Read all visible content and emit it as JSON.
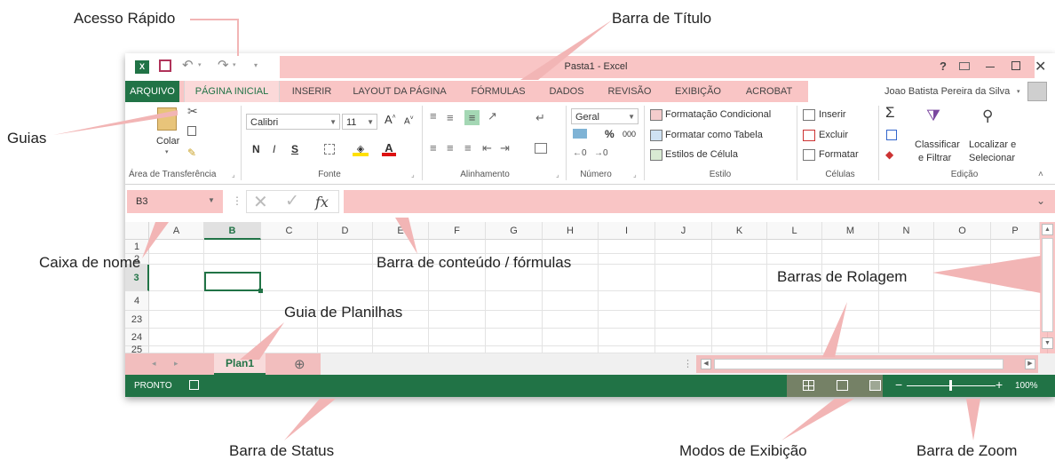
{
  "callouts": {
    "quick_access": "Acesso Rápido",
    "title_bar": "Barra de Título",
    "tabs": "Guias",
    "name_box": "Caixa de nome",
    "formula_bar": "Barra de conteúdo / fórmulas",
    "scroll_bars": "Barras de Rolagem",
    "sheet_tabs": "Guia de Planilhas",
    "status_bar": "Barra de Status",
    "view_modes": "Modos de Exibição",
    "zoom_bar": "Barra de Zoom"
  },
  "window": {
    "title": "Pasta1 - Excel",
    "help": "?",
    "user": "Joao Batista Pereira da Silva"
  },
  "tabs": [
    "PÁGINA INICIAL",
    "INSERIR",
    "LAYOUT DA PÁGINA",
    "FÓRMULAS",
    "DADOS",
    "REVISÃO",
    "EXIBIÇÃO",
    "ACROBAT"
  ],
  "file_tab": "ARQUIVO",
  "ribbon": {
    "paste": "Colar",
    "clipboard": "Área de Transferência",
    "font_name": "Calibri",
    "font_size": "11",
    "bold": "N",
    "italic": "I",
    "underline": "S",
    "font_group": "Fonte",
    "align_group": "Alinhamento",
    "number_format": "Geral",
    "percent": "%",
    "thousands": "000",
    "number_group": "Número",
    "cond_format": "Formatação Condicional",
    "format_table": "Formatar como Tabela",
    "cell_styles": "Estilos de Célula",
    "style_group": "Estilo",
    "insert": "Inserir",
    "delete": "Excluir",
    "format": "Formatar",
    "cells_group": "Células",
    "sort_1": "Classificar",
    "sort_2": "e Filtrar",
    "find_1": "Localizar e",
    "find_2": "Selecionar",
    "edit_group": "Edição"
  },
  "name_box": "B3",
  "fx": "fx",
  "columns": [
    "A",
    "B",
    "C",
    "D",
    "E",
    "F",
    "G",
    "H",
    "I",
    "J",
    "K",
    "L",
    "M",
    "N",
    "O",
    "P"
  ],
  "rows": [
    "1",
    "2",
    "3",
    "4",
    "23",
    "24",
    "25"
  ],
  "sheet": {
    "tab": "Plan1",
    "add": "⊕"
  },
  "status": {
    "ready": "PRONTO",
    "zoom": "100%"
  },
  "colors": {
    "excel_green": "#217346",
    "highlight": "#f49696"
  }
}
